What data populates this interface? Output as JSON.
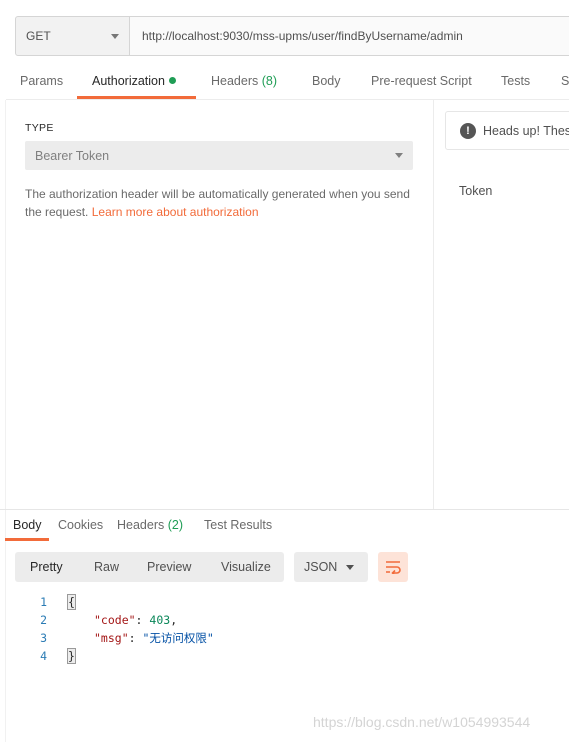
{
  "request": {
    "method": "GET",
    "url": "http://localhost:9030/mss-upms/user/findByUsername/admin"
  },
  "request_tabs": {
    "params": "Params",
    "authorization": "Authorization",
    "headers": "Headers",
    "headers_count": "(8)",
    "body": "Body",
    "pre_request": "Pre-request Script",
    "tests": "Tests",
    "settings_partial": "Se"
  },
  "auth": {
    "type_label": "TYPE",
    "type_value": "Bearer Token",
    "description": "The authorization header will be automatically generated when you send the request.",
    "learn_more": "Learn more about authorization",
    "heads_up": "Heads up! Thes",
    "token_label": "Token"
  },
  "response_tabs": {
    "body": "Body",
    "cookies": "Cookies",
    "headers": "Headers",
    "headers_count": "(2)",
    "test_results": "Test Results"
  },
  "view": {
    "pretty": "Pretty",
    "raw": "Raw",
    "preview": "Preview",
    "visualize": "Visualize",
    "format": "JSON"
  },
  "code": {
    "line_numbers": [
      "1",
      "2",
      "3",
      "4"
    ],
    "open_brace": "{",
    "close_brace": "}",
    "code_key": "\"code\"",
    "code_value": "403",
    "msg_key": "\"msg\"",
    "msg_value": "\"无访问权限\"",
    "colon": ": ",
    "comma": ","
  },
  "watermark": "https://blog.csdn.net/w1054993544",
  "colors": {
    "accent": "#f26b3a",
    "green": "#1f9d55"
  }
}
